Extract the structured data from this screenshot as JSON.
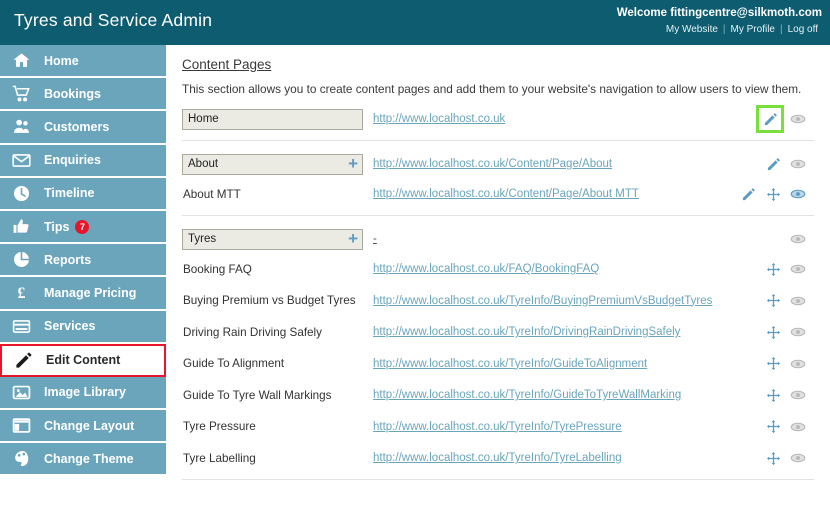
{
  "header": {
    "app_title": "Tyres and Service Admin",
    "welcome": "Welcome fittingcentre@silkmoth.com",
    "links": [
      {
        "label": "My Website",
        "name": "my-website-link"
      },
      {
        "label": "My Profile",
        "name": "my-profile-link"
      },
      {
        "label": "Log off",
        "name": "log-off-link"
      }
    ],
    "separator": "|",
    "bg_color": "#0d5c70"
  },
  "sidebar": {
    "bg_color": "#6aa5bb",
    "active_border_color": "#e8152a",
    "items": [
      {
        "label": "Home",
        "icon": "home-icon",
        "active": false,
        "badge": null
      },
      {
        "label": "Bookings",
        "icon": "shopping-cart-icon",
        "active": false,
        "badge": null
      },
      {
        "label": "Customers",
        "icon": "users-icon",
        "active": false,
        "badge": null
      },
      {
        "label": "Enquiries",
        "icon": "envelope-icon",
        "active": false,
        "badge": null
      },
      {
        "label": "Timeline",
        "icon": "clock-icon",
        "active": false,
        "badge": null
      },
      {
        "label": "Tips",
        "icon": "thumbs-up-icon",
        "active": false,
        "badge": "7"
      },
      {
        "label": "Reports",
        "icon": "pie-chart-icon",
        "active": false,
        "badge": null
      },
      {
        "label": "Manage Pricing",
        "icon": "pound-sign-icon",
        "active": false,
        "badge": null
      },
      {
        "label": "Services",
        "icon": "card-list-icon",
        "active": false,
        "badge": null
      },
      {
        "label": "Edit Content",
        "icon": "pencil-icon",
        "active": true,
        "badge": null
      },
      {
        "label": "Image Library",
        "icon": "image-icon",
        "active": false,
        "badge": null
      },
      {
        "label": "Change Layout",
        "icon": "layout-icon",
        "active": false,
        "badge": null
      },
      {
        "label": "Change Theme",
        "icon": "paint-icon",
        "active": false,
        "badge": null
      }
    ]
  },
  "main": {
    "title": "Content Pages",
    "description": "This section allows you to create content pages and add them to your website's navigation to allow users to view them.",
    "groups": [
      {
        "name_value": "Home",
        "has_plus": false,
        "url": "http://www.localhost.co.uk",
        "actions": [
          {
            "icon": "pencil-icon",
            "style": "blue",
            "highlighted": true
          },
          {
            "icon": "eye-icon",
            "style": "grey",
            "highlighted": false
          }
        ],
        "children": [],
        "divider_after": true
      },
      {
        "name_value": "About",
        "has_plus": true,
        "plus_label": "+",
        "url": "http://www.localhost.co.uk/Content/Page/About",
        "actions": [
          {
            "icon": "pencil-icon",
            "style": "blue",
            "highlighted": false
          },
          {
            "icon": "eye-icon",
            "style": "grey",
            "highlighted": false
          }
        ],
        "children": [
          {
            "name": "About MTT",
            "url": "http://www.localhost.co.uk/Content/Page/About MTT",
            "actions": [
              {
                "icon": "pencil-icon",
                "style": "blue",
                "highlighted": false
              },
              {
                "icon": "move-icon",
                "style": "blue",
                "highlighted": false
              },
              {
                "icon": "eye-icon",
                "style": "blue",
                "highlighted": false
              }
            ]
          }
        ],
        "divider_after": true
      },
      {
        "name_value": "Tyres",
        "has_plus": true,
        "plus_label": "+",
        "url": "-",
        "url_is_dash": true,
        "actions": [
          {
            "icon": "eye-icon",
            "style": "grey",
            "highlighted": false
          }
        ],
        "children": [
          {
            "name": "Booking FAQ",
            "url": "http://www.localhost.co.uk/FAQ/BookingFAQ",
            "actions": [
              {
                "icon": "move-icon",
                "style": "blue",
                "highlighted": false
              },
              {
                "icon": "eye-icon",
                "style": "grey",
                "highlighted": false
              }
            ]
          },
          {
            "name": "Buying Premium vs Budget Tyres",
            "url": "http://www.localhost.co.uk/TyreInfo/BuyingPremiumVsBudgetTyres",
            "actions": [
              {
                "icon": "move-icon",
                "style": "blue",
                "highlighted": false
              },
              {
                "icon": "eye-icon",
                "style": "grey",
                "highlighted": false
              }
            ]
          },
          {
            "name": "Driving Rain Driving Safely",
            "url": "http://www.localhost.co.uk/TyreInfo/DrivingRainDrivingSafely",
            "actions": [
              {
                "icon": "move-icon",
                "style": "blue",
                "highlighted": false
              },
              {
                "icon": "eye-icon",
                "style": "grey",
                "highlighted": false
              }
            ]
          },
          {
            "name": "Guide To Alignment",
            "url": "http://www.localhost.co.uk/TyreInfo/GuideToAlignment",
            "actions": [
              {
                "icon": "move-icon",
                "style": "blue",
                "highlighted": false
              },
              {
                "icon": "eye-icon",
                "style": "grey",
                "highlighted": false
              }
            ]
          },
          {
            "name": "Guide To Tyre Wall Markings",
            "url": "http://www.localhost.co.uk/TyreInfo/GuideToTyreWallMarking",
            "actions": [
              {
                "icon": "move-icon",
                "style": "blue",
                "highlighted": false
              },
              {
                "icon": "eye-icon",
                "style": "grey",
                "highlighted": false
              }
            ]
          },
          {
            "name": "Tyre Pressure",
            "url": "http://www.localhost.co.uk/TyreInfo/TyrePressure",
            "actions": [
              {
                "icon": "move-icon",
                "style": "blue",
                "highlighted": false
              },
              {
                "icon": "eye-icon",
                "style": "grey",
                "highlighted": false
              }
            ]
          },
          {
            "name": "Tyre Labelling",
            "url": "http://www.localhost.co.uk/TyreInfo/TyreLabelling",
            "actions": [
              {
                "icon": "move-icon",
                "style": "blue",
                "highlighted": false
              },
              {
                "icon": "eye-icon",
                "style": "grey",
                "highlighted": false
              }
            ]
          }
        ],
        "divider_after": true
      }
    ]
  },
  "colors": {
    "brand_dark": "#0d5c70",
    "brand_light": "#6aa5bb",
    "accent_blue": "#5b9bc4",
    "highlight_green": "#78e03a",
    "alert_red": "#e8152a",
    "input_bg": "#ebebe4"
  }
}
